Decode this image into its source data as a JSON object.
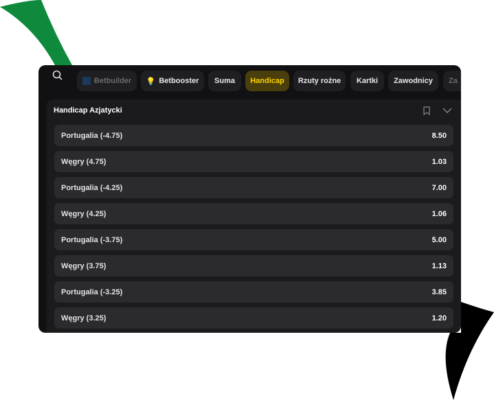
{
  "tabs": [
    {
      "label": "Betbuilder",
      "icon": "betbuilder-icon"
    },
    {
      "label": "Betbooster",
      "icon": "lightbulb-icon"
    },
    {
      "label": "Suma"
    },
    {
      "label": "Handicap",
      "active": true
    },
    {
      "label": "Rzuty rożne"
    },
    {
      "label": "Kartki"
    },
    {
      "label": "Zawodnicy"
    },
    {
      "label": "Za"
    }
  ],
  "market": {
    "title": "Handicap Azjatycki",
    "rows": [
      {
        "label": "Portugalia (-4.75)",
        "odds": "8.50"
      },
      {
        "label": "Węgry (4.75)",
        "odds": "1.03"
      },
      {
        "label": "Portugalia (-4.25)",
        "odds": "7.00"
      },
      {
        "label": "Węgry (4.25)",
        "odds": "1.06"
      },
      {
        "label": "Portugalia (-3.75)",
        "odds": "5.00"
      },
      {
        "label": "Węgry (3.75)",
        "odds": "1.13"
      },
      {
        "label": "Portugalia (-3.25)",
        "odds": "3.85"
      },
      {
        "label": "Węgry (3.25)",
        "odds": "1.20"
      }
    ]
  },
  "colors": {
    "accent": "#ffd400",
    "green": "#0f8a3c"
  }
}
